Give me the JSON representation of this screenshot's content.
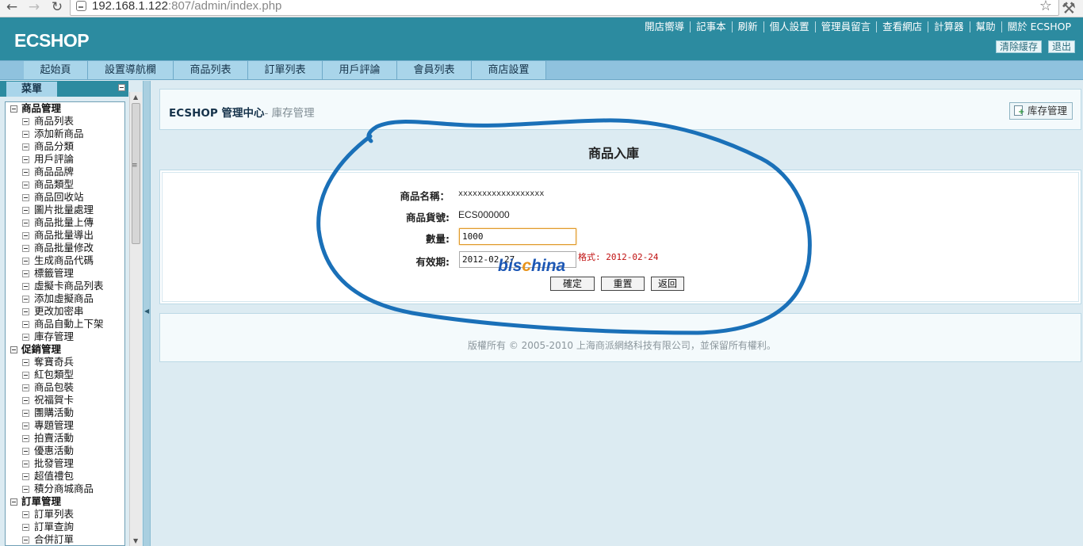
{
  "browser": {
    "url_host": "192.168.1.122",
    "url_rest": ":807/admin/index.php"
  },
  "header": {
    "logo": "ECSHOP",
    "top_links": [
      "開店嚮導",
      "記事本",
      "刷新",
      "個人設置",
      "管理員留言",
      "查看網店",
      "計算器",
      "幫助",
      "關於 ECSHOP"
    ],
    "clear_cache": "清除緩存",
    "logout": "退出"
  },
  "tabs": [
    "起始頁",
    "設置導航欄",
    "商品列表",
    "訂單列表",
    "用戶評論",
    "會員列表",
    "商店設置"
  ],
  "sidebar": {
    "title": "菜單",
    "groups": [
      {
        "label": "商品管理",
        "items": [
          "商品列表",
          "添加新商品",
          "商品分類",
          "用戶評論",
          "商品品牌",
          "商品類型",
          "商品回收站",
          "圖片批量處理",
          "商品批量上傳",
          "商品批量導出",
          "商品批量修改",
          "生成商品代碼",
          "標籤管理",
          "虛擬卡商品列表",
          "添加虛擬商品",
          "更改加密串",
          "商品自動上下架",
          "庫存管理"
        ]
      },
      {
        "label": "促銷管理",
        "items": [
          "奪寶奇兵",
          "紅包類型",
          "商品包裝",
          "祝福賀卡",
          "團購活動",
          "專題管理",
          "拍賣活動",
          "優惠活動",
          "批發管理",
          "超值禮包",
          "積分商城商品"
        ]
      },
      {
        "label": "訂單管理",
        "items": [
          "訂單列表",
          "訂單查詢",
          "合併訂單"
        ]
      }
    ]
  },
  "content": {
    "breadcrumb_main": "ECSHOP 管理中心",
    "breadcrumb_sub": "- 庫存管理",
    "action_button": "库存管理",
    "page_heading": "商品入庫",
    "form": {
      "name_label": "商品名稱：",
      "name_value": "xxxxxxxxxxxxxxxxxx",
      "sn_label": "商品貨號:",
      "sn_value": "ECS000000",
      "qty_label": "數量:",
      "qty_value": "1000",
      "expiry_label": "有效期:",
      "expiry_value": "2012-02-27",
      "format_hint": "格式: 2012-02-24",
      "submit": "確定",
      "reset": "重置",
      "back": "返回"
    },
    "watermark_a": "bis",
    "watermark_c": "c",
    "watermark_b": "hina",
    "copyright": "版權所有 © 2005-2010 上海商派網絡科技有限公司，並保留所有權利。"
  },
  "colors": {
    "header": "#2c8ba0",
    "tab_bg": "#a9d5ea",
    "annotation_stroke": "#1a70b8",
    "format_hint": "#c01010"
  }
}
